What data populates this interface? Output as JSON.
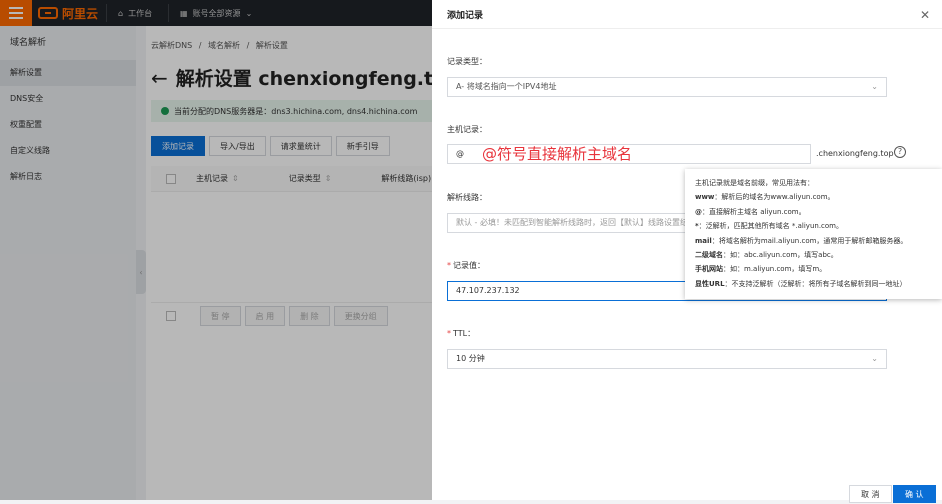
{
  "topbar": {
    "logo_text": "阿里云",
    "workbench_label": "工作台",
    "account_label": "账号全部资源"
  },
  "leftnav": {
    "title": "域名解析",
    "items": [
      {
        "label": "解析设置"
      },
      {
        "label": "DNS安全"
      },
      {
        "label": "权重配置"
      },
      {
        "label": "自定义线路"
      },
      {
        "label": "解析日志"
      }
    ]
  },
  "main": {
    "breadcrumb": [
      "云解析DNS",
      "/",
      "域名解析",
      "/",
      "解析设置"
    ],
    "title": "解析设置 chenxiongfeng.top",
    "dns_notice": "当前分配的DNS服务器是：dns3.hichina.com, dns4.hichina.com",
    "buttons": [
      "添加记录",
      "导入/导出",
      "请求量统计",
      "新手引导"
    ],
    "columns": [
      "主机记录",
      "记录类型",
      "解析线路(isp)"
    ],
    "footer_buttons": [
      "暂 停",
      "启 用",
      "删 除",
      "更换分组"
    ]
  },
  "drawer": {
    "title": "添加记录",
    "record_type": {
      "label": "记录类型：",
      "value": "A- 将域名指向一个IPV4地址"
    },
    "host": {
      "label": "主机记录：",
      "value": "@",
      "annotation": "@符号直接解析主域名",
      "suffix": ".chenxiongfeng.top"
    },
    "line": {
      "label": "解析线路：",
      "value": "默认 - 必填！未匹配到智能解析线路时，返回【默认】线路设置结果"
    },
    "record_value": {
      "label": "记录值：",
      "value": "47.107.237.132"
    },
    "ttl": {
      "label": "TTL：",
      "value": "10 分钟"
    },
    "cancel_label": "取 消",
    "confirm_label": "确 认"
  },
  "tooltip": {
    "lines": [
      {
        "bold": "",
        "text": "主机记录就是域名前缀，常见用法有："
      },
      {
        "bold": "www",
        "text": "：解析后的域名为www.aliyun.com。"
      },
      {
        "bold": "@",
        "text": "：直接解析主域名 aliyun.com。"
      },
      {
        "bold": "*",
        "text": "：泛解析，匹配其他所有域名 *.aliyun.com。"
      },
      {
        "bold": "mail",
        "text": "：将域名解析为mail.aliyun.com，通常用于解析邮箱服务器。"
      },
      {
        "bold": "二级域名",
        "text": "：如：abc.aliyun.com，填写abc。"
      },
      {
        "bold": "手机网站",
        "text": "：如：m.aliyun.com，填写m。"
      },
      {
        "bold": "显性URL",
        "text": "：不支持泛解析（泛解析：将所有子域名解析到同一地址）"
      }
    ]
  },
  "colors": {
    "accent": "#0a6fd6",
    "brand": "#ff6a00",
    "annotation": "#e8343c"
  }
}
